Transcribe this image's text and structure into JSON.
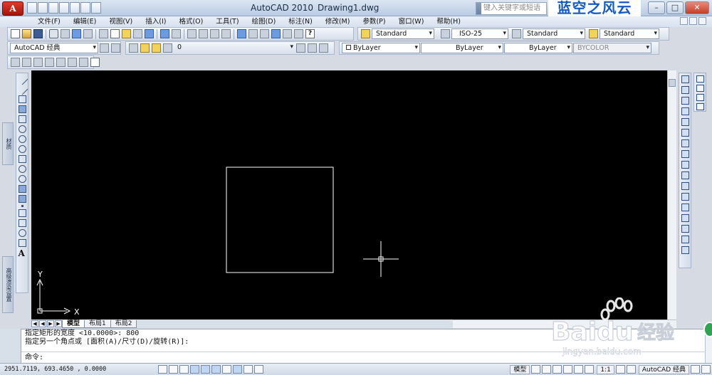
{
  "window": {
    "app_button": "A",
    "app_title": "AutoCAD 2010",
    "document_title": "Drawing1.dwg",
    "search_placeholder": "键入关键字或短语",
    "watermark_text": "蓝空之风云"
  },
  "menu": [
    "文件(F)",
    "编辑(E)",
    "视图(V)",
    "插入(I)",
    "格式(O)",
    "工具(T)",
    "绘图(D)",
    "标注(N)",
    "修改(M)",
    "参数(P)",
    "窗口(W)",
    "帮助(H)"
  ],
  "styles": {
    "text_style": "Standard",
    "dim_style": "ISO-25",
    "table_style": "Standard",
    "multileader_style": "Standard"
  },
  "workspace": "AutoCAD 经典",
  "layer": "0",
  "properties": {
    "color": "ByLayer",
    "linetype": "ByLayer",
    "lineweight": "ByLayer",
    "plotstyle": "BYCOLOR"
  },
  "palettes": {
    "materials": "材质",
    "advanced_render": "高级渲染设置"
  },
  "drawing": {
    "background": "#000000",
    "line_color": "#ffffff",
    "ucs_x": "X",
    "ucs_y": "Y"
  },
  "layout_tabs": [
    "模型",
    "布局1",
    "布局2"
  ],
  "command_history": [
    "指定矩形的宽度 <10.0000>: 800",
    "指定另一个角点或 [面积(A)/尺寸(D)/旋转(R)]:"
  ],
  "command_prompt": "命令:",
  "status": {
    "coordinates": "2951.7119, 693.4650 , 0.0000",
    "model_label": "模型",
    "scale": "1:1",
    "workspace": "AutoCAD 经典"
  },
  "baidu_watermark": {
    "brand": "Baidu",
    "brand_cn": "经验",
    "url": "jingyan.baidu.com"
  }
}
